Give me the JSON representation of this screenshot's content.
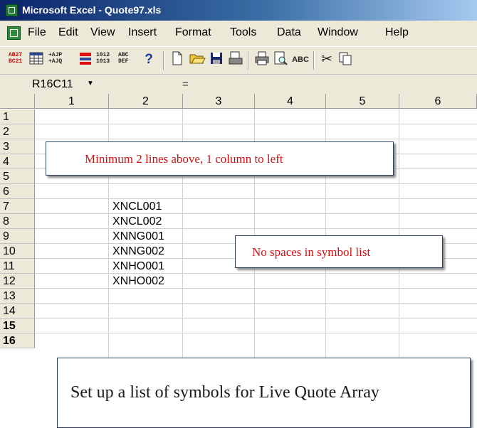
{
  "window": {
    "title": "Microsoft Excel - Quote97.xls"
  },
  "menu": [
    "File",
    "Edit",
    "View",
    "Insert",
    "Format",
    "Tools",
    "Data",
    "Window",
    "Help"
  ],
  "toolbar": {
    "icons": [
      "ab27-bc21-icon",
      "table-icon",
      "ajp-ajq-icon",
      "filter-icon",
      "1012-1013-icon",
      "abc-def-icon",
      "help-icon",
      "new-icon",
      "open-icon",
      "save-icon",
      "print-preview-icon",
      "print-icon",
      "preview-icon",
      "spelling-icon",
      "cut-icon",
      "copy-icon"
    ],
    "labels": {
      "ab27": "AB27\nBC21",
      "ajp": "+AJP\n+AJQ",
      "num": "1012\n1013",
      "abc": "ABC\nDEF"
    }
  },
  "formula_bar": {
    "name_box": "R16C11",
    "equals": "="
  },
  "grid": {
    "columns": [
      "1",
      "2",
      "3",
      "4",
      "5",
      "6"
    ],
    "rows": [
      "1",
      "2",
      "3",
      "4",
      "5",
      "6",
      "7",
      "8",
      "9",
      "10",
      "11",
      "12",
      "13",
      "14",
      "15",
      "16"
    ],
    "cells": [
      "XNCL001",
      "XNCL002",
      "XNNG001",
      "XNNG002",
      "XNHO001",
      "XNHO002"
    ]
  },
  "callouts": {
    "c1": "Minimum 2 lines above, 1 column to left",
    "c2": "No spaces in symbol list",
    "c3": "Set up a list of symbols for Live Quote Array"
  }
}
